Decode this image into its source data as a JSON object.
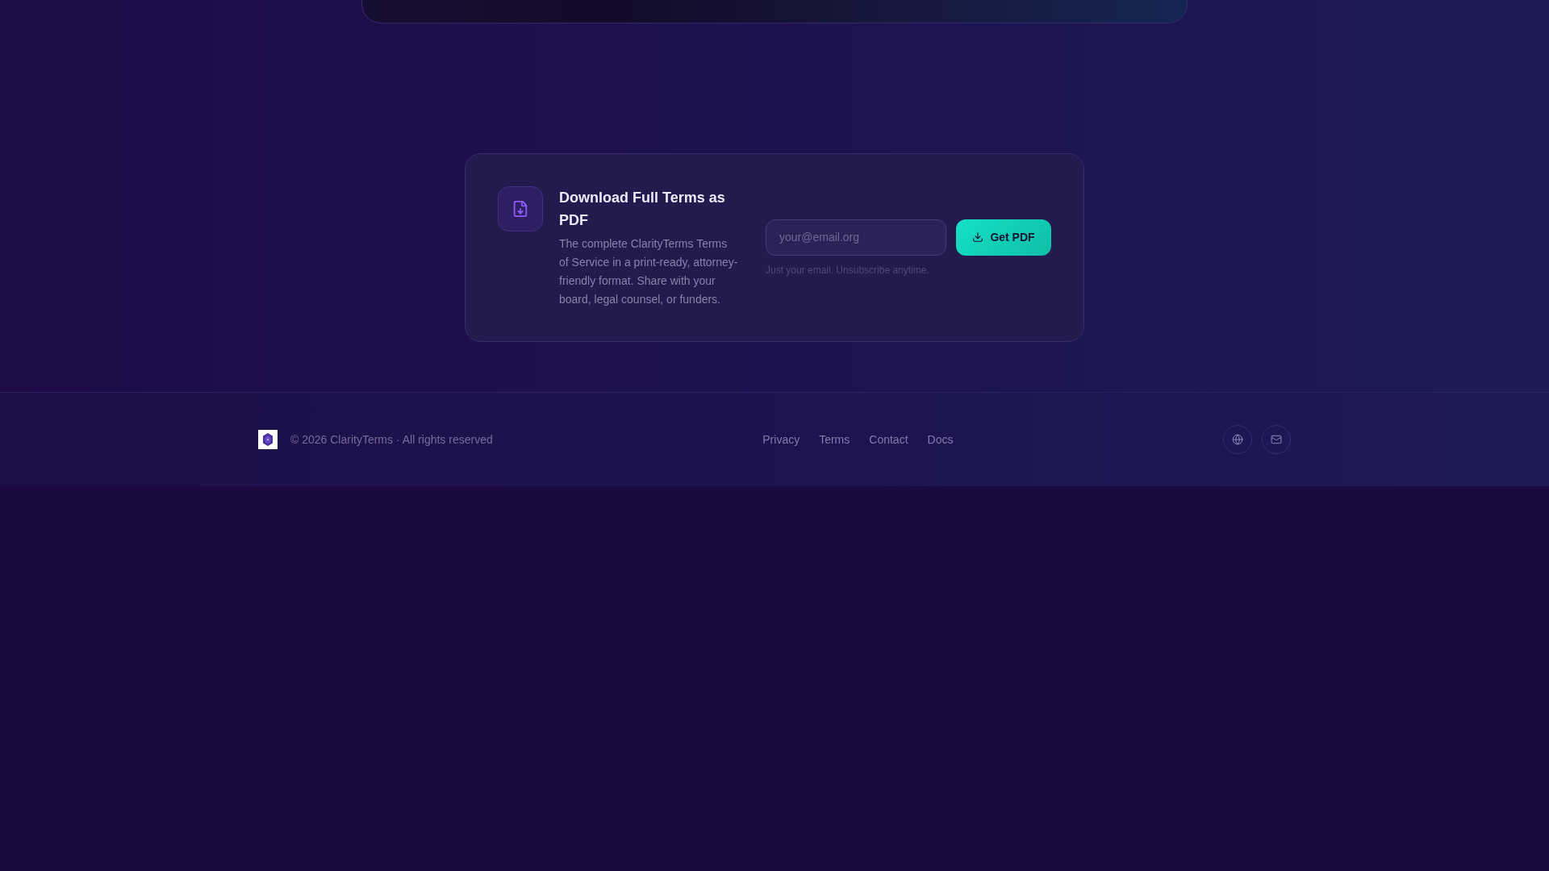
{
  "download_card": {
    "title": "Download Full Terms as PDF",
    "description": "The complete ClarityTerms Terms of Service in a print-ready, attorney-friendly format. Share with your board, legal counsel, or funders.",
    "email_field": {
      "placeholder": "your@email.org"
    },
    "button": "Get PDF",
    "hint": "Just your email. Unsubscribe anytime."
  },
  "footer": {
    "copyright": "© 2026 ClarityTerms · All rights reserved",
    "links": [
      "Privacy",
      "Terms",
      "Contact",
      "Docs"
    ]
  }
}
